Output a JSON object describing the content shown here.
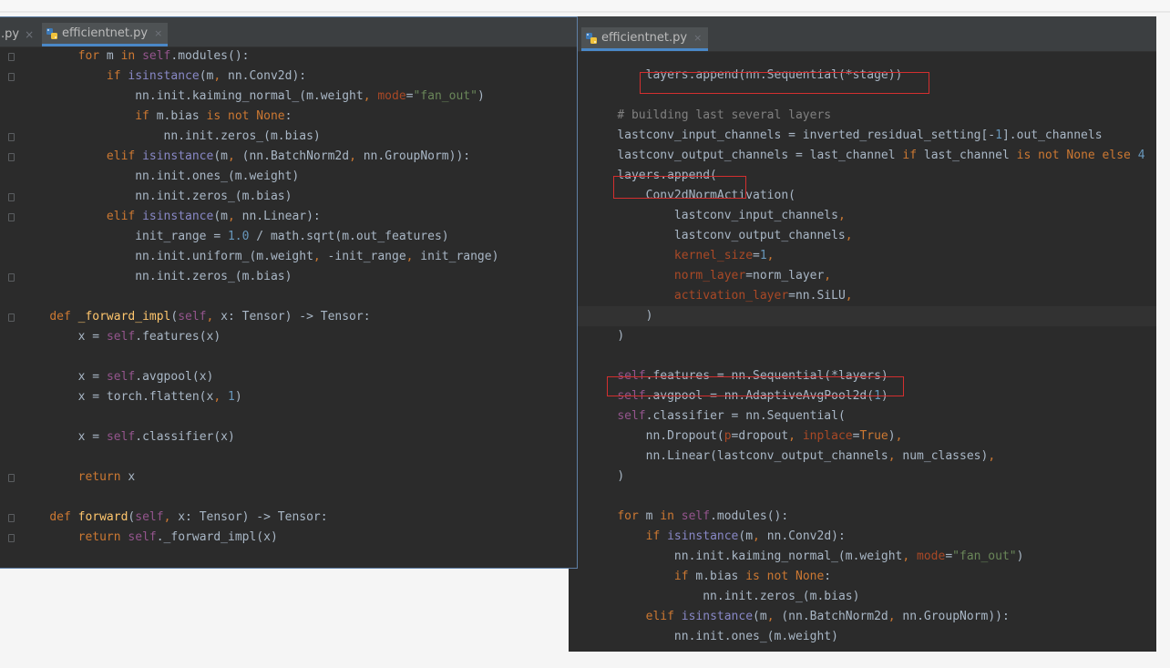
{
  "left_editor": {
    "prev_tab_label": ".py",
    "prev_tab_close": "×",
    "active_tab_label": "efficientnet.py",
    "active_tab_close": "×",
    "lines": [
      {
        "indent": "        ",
        "tokens": [
          {
            "t": "for",
            "c": "kw"
          },
          {
            "t": " m ",
            "c": "pl"
          },
          {
            "t": "in",
            "c": "kw"
          },
          {
            "t": " ",
            "c": "pl"
          },
          {
            "t": "self",
            "c": "sf"
          },
          {
            "t": ".modules():",
            "c": "pl"
          }
        ]
      },
      {
        "indent": "            ",
        "tokens": [
          {
            "t": "if",
            "c": "kw"
          },
          {
            "t": " ",
            "c": "pl"
          },
          {
            "t": "isinstance",
            "c": "bi"
          },
          {
            "t": "(m",
            "c": "pl"
          },
          {
            "t": ",",
            "c": "kw"
          },
          {
            "t": " nn.Conv2d):",
            "c": "pl"
          }
        ]
      },
      {
        "indent": "                ",
        "tokens": [
          {
            "t": "nn.init.kaiming_normal_(m.weight",
            "c": "pl"
          },
          {
            "t": ",",
            "c": "kw"
          },
          {
            "t": " ",
            "c": "pl"
          },
          {
            "t": "mode",
            "c": "pm"
          },
          {
            "t": "=",
            "c": "pl"
          },
          {
            "t": "\"fan_out\"",
            "c": "st"
          },
          {
            "t": ")",
            "c": "pl"
          }
        ]
      },
      {
        "indent": "                ",
        "tokens": [
          {
            "t": "if",
            "c": "kw"
          },
          {
            "t": " m.bias ",
            "c": "pl"
          },
          {
            "t": "is not None",
            "c": "kw"
          },
          {
            "t": ":",
            "c": "pl"
          }
        ]
      },
      {
        "indent": "                    ",
        "tokens": [
          {
            "t": "nn.init.zeros_(m.bias)",
            "c": "pl"
          }
        ]
      },
      {
        "indent": "            ",
        "tokens": [
          {
            "t": "elif",
            "c": "kw"
          },
          {
            "t": " ",
            "c": "pl"
          },
          {
            "t": "isinstance",
            "c": "bi"
          },
          {
            "t": "(m",
            "c": "pl"
          },
          {
            "t": ",",
            "c": "kw"
          },
          {
            "t": " (nn.BatchNorm2d",
            "c": "pl"
          },
          {
            "t": ",",
            "c": "kw"
          },
          {
            "t": " nn.GroupNorm)):",
            "c": "pl"
          }
        ]
      },
      {
        "indent": "                ",
        "tokens": [
          {
            "t": "nn.init.ones_(m.weight)",
            "c": "pl"
          }
        ]
      },
      {
        "indent": "                ",
        "tokens": [
          {
            "t": "nn.init.zeros_(m.bias)",
            "c": "pl"
          }
        ]
      },
      {
        "indent": "            ",
        "tokens": [
          {
            "t": "elif",
            "c": "kw"
          },
          {
            "t": " ",
            "c": "pl"
          },
          {
            "t": "isinstance",
            "c": "bi"
          },
          {
            "t": "(m",
            "c": "pl"
          },
          {
            "t": ",",
            "c": "kw"
          },
          {
            "t": " nn.Linear):",
            "c": "pl"
          }
        ]
      },
      {
        "indent": "                ",
        "tokens": [
          {
            "t": "init_range = ",
            "c": "pl"
          },
          {
            "t": "1.0",
            "c": "nm"
          },
          {
            "t": " / math.sqrt(m.out_features)",
            "c": "pl"
          }
        ]
      },
      {
        "indent": "                ",
        "tokens": [
          {
            "t": "nn.init.uniform_(m.weight",
            "c": "pl"
          },
          {
            "t": ",",
            "c": "kw"
          },
          {
            "t": " -init_range",
            "c": "pl"
          },
          {
            "t": ",",
            "c": "kw"
          },
          {
            "t": " init_range)",
            "c": "pl"
          }
        ]
      },
      {
        "indent": "                ",
        "tokens": [
          {
            "t": "nn.init.zeros_(m.bias)",
            "c": "pl"
          }
        ]
      },
      {
        "indent": "",
        "tokens": []
      },
      {
        "indent": "    ",
        "tokens": [
          {
            "t": "def",
            "c": "kw"
          },
          {
            "t": " ",
            "c": "pl"
          },
          {
            "t": "_forward_impl",
            "c": "fn"
          },
          {
            "t": "(",
            "c": "pl"
          },
          {
            "t": "self",
            "c": "sf"
          },
          {
            "t": ",",
            "c": "kw"
          },
          {
            "t": " x: Tensor) -> Tensor:",
            "c": "pl"
          }
        ]
      },
      {
        "indent": "        ",
        "tokens": [
          {
            "t": "x = ",
            "c": "pl"
          },
          {
            "t": "self",
            "c": "sf"
          },
          {
            "t": ".features(x)",
            "c": "pl"
          }
        ]
      },
      {
        "indent": "",
        "tokens": []
      },
      {
        "indent": "        ",
        "tokens": [
          {
            "t": "x = ",
            "c": "pl"
          },
          {
            "t": "self",
            "c": "sf"
          },
          {
            "t": ".avgpool(x)",
            "c": "pl"
          }
        ]
      },
      {
        "indent": "        ",
        "tokens": [
          {
            "t": "x = torch.flatten(x",
            "c": "pl"
          },
          {
            "t": ",",
            "c": "kw"
          },
          {
            "t": " ",
            "c": "pl"
          },
          {
            "t": "1",
            "c": "nm"
          },
          {
            "t": ")",
            "c": "pl"
          }
        ]
      },
      {
        "indent": "",
        "tokens": []
      },
      {
        "indent": "        ",
        "tokens": [
          {
            "t": "x = ",
            "c": "pl"
          },
          {
            "t": "self",
            "c": "sf"
          },
          {
            "t": ".classifier(x)",
            "c": "pl"
          }
        ]
      },
      {
        "indent": "",
        "tokens": []
      },
      {
        "indent": "        ",
        "tokens": [
          {
            "t": "return",
            "c": "kw"
          },
          {
            "t": " x",
            "c": "pl"
          }
        ]
      },
      {
        "indent": "",
        "tokens": []
      },
      {
        "indent": "    ",
        "tokens": [
          {
            "t": "def",
            "c": "kw"
          },
          {
            "t": " ",
            "c": "pl"
          },
          {
            "t": "forward",
            "c": "fn"
          },
          {
            "t": "(",
            "c": "pl"
          },
          {
            "t": "self",
            "c": "sf"
          },
          {
            "t": ",",
            "c": "kw"
          },
          {
            "t": " x: Tensor) -> Tensor:",
            "c": "pl"
          }
        ]
      },
      {
        "indent": "        ",
        "tokens": [
          {
            "t": "return",
            "c": "kw"
          },
          {
            "t": " ",
            "c": "pl"
          },
          {
            "t": "self",
            "c": "sf"
          },
          {
            "t": "._forward_impl(x)",
            "c": "pl"
          }
        ]
      }
    ]
  },
  "right_editor": {
    "active_tab_label": "efficientnet.py",
    "active_tab_close": "×",
    "lines": [
      {
        "indent": "",
        "tokens": []
      },
      {
        "indent": "        ",
        "tokens": [
          {
            "t": "layers.append(nn.Sequential(*stage))",
            "c": "pl"
          }
        ]
      },
      {
        "indent": "",
        "tokens": []
      },
      {
        "indent": "    ",
        "tokens": [
          {
            "t": "# building last several layers",
            "c": "cm"
          }
        ]
      },
      {
        "indent": "    ",
        "tokens": [
          {
            "t": "lastconv_input_channels = inverted_residual_setting[-",
            "c": "pl"
          },
          {
            "t": "1",
            "c": "nm"
          },
          {
            "t": "].out_channels",
            "c": "pl"
          }
        ]
      },
      {
        "indent": "    ",
        "tokens": [
          {
            "t": "lastconv_output_channels = last_channel ",
            "c": "pl"
          },
          {
            "t": "if",
            "c": "kw"
          },
          {
            "t": " last_channel ",
            "c": "pl"
          },
          {
            "t": "is not None else",
            "c": "kw"
          },
          {
            "t": " ",
            "c": "pl"
          },
          {
            "t": "4",
            "c": "nm"
          }
        ]
      },
      {
        "indent": "    ",
        "tokens": [
          {
            "t": "layers.append(",
            "c": "pl"
          }
        ]
      },
      {
        "indent": "        ",
        "tokens": [
          {
            "t": "Conv2dNormActivation(",
            "c": "pl"
          }
        ]
      },
      {
        "indent": "            ",
        "tokens": [
          {
            "t": "lastconv_input_channels",
            "c": "pl"
          },
          {
            "t": ",",
            "c": "kw"
          }
        ]
      },
      {
        "indent": "            ",
        "tokens": [
          {
            "t": "lastconv_output_channels",
            "c": "pl"
          },
          {
            "t": ",",
            "c": "kw"
          }
        ]
      },
      {
        "indent": "            ",
        "tokens": [
          {
            "t": "kernel_size",
            "c": "pm"
          },
          {
            "t": "=",
            "c": "pl"
          },
          {
            "t": "1",
            "c": "nm"
          },
          {
            "t": ",",
            "c": "kw"
          }
        ]
      },
      {
        "indent": "            ",
        "tokens": [
          {
            "t": "norm_layer",
            "c": "pm"
          },
          {
            "t": "=norm_layer",
            "c": "pl"
          },
          {
            "t": ",",
            "c": "kw"
          }
        ]
      },
      {
        "indent": "            ",
        "tokens": [
          {
            "t": "activation_layer",
            "c": "pm"
          },
          {
            "t": "=nn.SiLU",
            "c": "pl"
          },
          {
            "t": ",",
            "c": "kw"
          }
        ]
      },
      {
        "indent": "        ",
        "tokens": [
          {
            "t": ")",
            "c": "pl"
          }
        ]
      },
      {
        "indent": "    ",
        "tokens": [
          {
            "t": ")",
            "c": "pl"
          }
        ]
      },
      {
        "indent": "",
        "tokens": []
      },
      {
        "indent": "    ",
        "tokens": [
          {
            "t": "self",
            "c": "sf"
          },
          {
            "t": ".features = nn.Sequential(*layers)",
            "c": "pl"
          }
        ]
      },
      {
        "indent": "    ",
        "tokens": [
          {
            "t": "self",
            "c": "sf"
          },
          {
            "t": ".avgpool = nn.AdaptiveAvgPool2d(",
            "c": "pl"
          },
          {
            "t": "1",
            "c": "nm"
          },
          {
            "t": ")",
            "c": "pl"
          }
        ]
      },
      {
        "indent": "    ",
        "tokens": [
          {
            "t": "self",
            "c": "sf"
          },
          {
            "t": ".classifier = nn.Sequential(",
            "c": "pl"
          }
        ]
      },
      {
        "indent": "        ",
        "tokens": [
          {
            "t": "nn.Dropout(",
            "c": "pl"
          },
          {
            "t": "p",
            "c": "pm"
          },
          {
            "t": "=dropout",
            "c": "pl"
          },
          {
            "t": ",",
            "c": "kw"
          },
          {
            "t": " ",
            "c": "pl"
          },
          {
            "t": "inplace",
            "c": "pm"
          },
          {
            "t": "=",
            "c": "pl"
          },
          {
            "t": "True",
            "c": "kw"
          },
          {
            "t": ")",
            "c": "pl"
          },
          {
            "t": ",",
            "c": "kw"
          }
        ]
      },
      {
        "indent": "        ",
        "tokens": [
          {
            "t": "nn.Linear(lastconv_output_channels",
            "c": "pl"
          },
          {
            "t": ",",
            "c": "kw"
          },
          {
            "t": " num_classes)",
            "c": "pl"
          },
          {
            "t": ",",
            "c": "kw"
          }
        ]
      },
      {
        "indent": "    ",
        "tokens": [
          {
            "t": ")",
            "c": "pl"
          }
        ]
      },
      {
        "indent": "",
        "tokens": []
      },
      {
        "indent": "    ",
        "tokens": [
          {
            "t": "for",
            "c": "kw"
          },
          {
            "t": " m ",
            "c": "pl"
          },
          {
            "t": "in",
            "c": "kw"
          },
          {
            "t": " ",
            "c": "pl"
          },
          {
            "t": "self",
            "c": "sf"
          },
          {
            "t": ".modules():",
            "c": "pl"
          }
        ]
      },
      {
        "indent": "        ",
        "tokens": [
          {
            "t": "if",
            "c": "kw"
          },
          {
            "t": " ",
            "c": "pl"
          },
          {
            "t": "isinstance",
            "c": "bi"
          },
          {
            "t": "(m",
            "c": "pl"
          },
          {
            "t": ",",
            "c": "kw"
          },
          {
            "t": " nn.Conv2d):",
            "c": "pl"
          }
        ]
      },
      {
        "indent": "            ",
        "tokens": [
          {
            "t": "nn.init.kaiming_normal_(m.weight",
            "c": "pl"
          },
          {
            "t": ",",
            "c": "kw"
          },
          {
            "t": " ",
            "c": "pl"
          },
          {
            "t": "mode",
            "c": "pm"
          },
          {
            "t": "=",
            "c": "pl"
          },
          {
            "t": "\"fan_out\"",
            "c": "st"
          },
          {
            "t": ")",
            "c": "pl"
          }
        ]
      },
      {
        "indent": "            ",
        "tokens": [
          {
            "t": "if",
            "c": "kw"
          },
          {
            "t": " m.bias ",
            "c": "pl"
          },
          {
            "t": "is not None",
            "c": "kw"
          },
          {
            "t": ":",
            "c": "pl"
          }
        ]
      },
      {
        "indent": "                ",
        "tokens": [
          {
            "t": "nn.init.zeros_(m.bias)",
            "c": "pl"
          }
        ]
      },
      {
        "indent": "        ",
        "tokens": [
          {
            "t": "elif",
            "c": "kw"
          },
          {
            "t": " ",
            "c": "pl"
          },
          {
            "t": "isinstance",
            "c": "bi"
          },
          {
            "t": "(m",
            "c": "pl"
          },
          {
            "t": ",",
            "c": "kw"
          },
          {
            "t": " (nn.BatchNorm2d",
            "c": "pl"
          },
          {
            "t": ",",
            "c": "kw"
          },
          {
            "t": " nn.GroupNorm)):",
            "c": "pl"
          }
        ]
      },
      {
        "indent": "            ",
        "tokens": [
          {
            "t": "nn.init.ones_(m.weight)",
            "c": "pl"
          }
        ]
      }
    ]
  }
}
